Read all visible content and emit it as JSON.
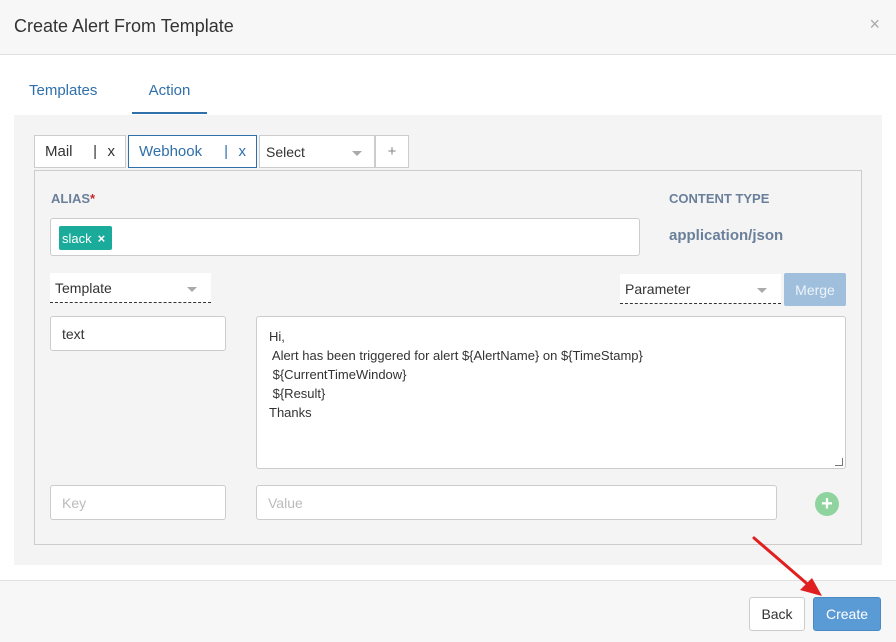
{
  "dialog": {
    "title": "Create Alert From Template",
    "close_label": "×"
  },
  "tabs": [
    {
      "label": "Templates",
      "active": false
    },
    {
      "label": "Action",
      "active": true
    }
  ],
  "action_chips": {
    "mail": {
      "label": "Mail",
      "separator": "|",
      "remove": "x"
    },
    "webhook": {
      "label": "Webhook",
      "separator": "|",
      "remove": "x",
      "active": true
    },
    "select": {
      "label": "Select"
    },
    "add": {
      "label": "+"
    }
  },
  "alias": {
    "label": "ALIAS",
    "required_mark": "*",
    "tags": [
      {
        "label": "slack",
        "remove": "×"
      }
    ]
  },
  "content_type": {
    "label": "CONTENT TYPE",
    "value": "application/json"
  },
  "template_dropdown": {
    "value": "Template"
  },
  "parameter_dropdown": {
    "value": "Parameter"
  },
  "merge_button": {
    "label": "Merge"
  },
  "fields": {
    "key_value": "text",
    "body": "Hi,\n Alert has been triggered for alert ${AlertName} on ${TimeStamp}\n ${CurrentTimeWindow}\n ${Result}\nThanks",
    "key_placeholder": "Key",
    "value_placeholder": "Value",
    "add_label": "+"
  },
  "footer": {
    "back_label": "Back",
    "create_label": "Create"
  },
  "colors": {
    "accent": "#2f6faa",
    "tag": "#1aab9b",
    "create_button": "#5b9bd5",
    "merge_button": "#9fbfdd",
    "add_icon": "#8fd49e",
    "annotation_arrow": "#e02020"
  }
}
